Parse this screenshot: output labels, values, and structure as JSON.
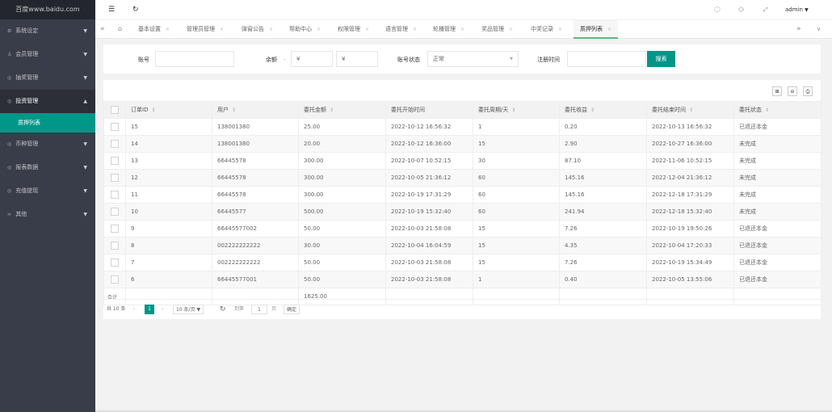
{
  "app": {
    "logo": "百度www.baidu.com"
  },
  "sidebar": {
    "items": [
      {
        "icon": "⚙",
        "label": "系统设定"
      },
      {
        "icon": "♙",
        "label": "会员管理"
      },
      {
        "icon": "◎",
        "label": "抽奖管理"
      },
      {
        "icon": "◎",
        "label": "投资管理"
      },
      {
        "icon": "◎",
        "label": "币种管理"
      },
      {
        "icon": "◎",
        "label": "报表数据"
      },
      {
        "icon": "◎",
        "label": "充值提现"
      },
      {
        "icon": "∞",
        "label": "其他"
      }
    ],
    "active_sub": "质押列表"
  },
  "topbar": {
    "user": "admin"
  },
  "tabs": [
    "基本设置",
    "管理员管理",
    "弹窗公告",
    "帮助中心",
    "权限管理",
    "语言管理",
    "轮播管理",
    "奖品管理",
    "中奖记录",
    "质押列表"
  ],
  "search": {
    "account_label": "账号",
    "balance_label": "余额",
    "balance_sep": "-",
    "min_placeholder": "¥",
    "max_placeholder": "¥",
    "status_label": "账号状态",
    "status_value": "正常",
    "regtime_label": "注册时间",
    "search_button": "搜索"
  },
  "table": {
    "columns": [
      "订单ID",
      "用户",
      "委托金额",
      "委托开始时间",
      "委托周期/天",
      "委托收益",
      "委托结束时间",
      "委托状态"
    ],
    "rows": [
      [
        "15",
        "138001380",
        "25.00",
        "2022-10-12 16:56:32",
        "1",
        "0.20",
        "2022-10-13 16:56:32",
        "已退还本金"
      ],
      [
        "14",
        "138001380",
        "20.00",
        "2022-10-12 16:36:00",
        "15",
        "2.90",
        "2022-10-27 16:36:00",
        "未完成"
      ],
      [
        "13",
        "66445578",
        "300.00",
        "2022-10-07 10:52:15",
        "30",
        "87.10",
        "2022-11-06 10:52:15",
        "未完成"
      ],
      [
        "12",
        "66445578",
        "300.00",
        "2022-10-05 21:36:12",
        "60",
        "145.16",
        "2022-12-04 21:36:12",
        "未完成"
      ],
      [
        "11",
        "66445578",
        "300.00",
        "2022-10-19 17:31:29",
        "60",
        "145.16",
        "2022-12-18 17:31:29",
        "未完成"
      ],
      [
        "10",
        "66445577",
        "500.00",
        "2022-10-19 15:32:40",
        "60",
        "241.94",
        "2022-12-18 15:32:40",
        "未完成"
      ],
      [
        "9",
        "66445577002",
        "50.00",
        "2022-10-03 21:58:08",
        "15",
        "7.26",
        "2022-10-19 19:50:26",
        "已退还本金"
      ],
      [
        "8",
        "002222222222",
        "30.00",
        "2022-10-04 16:04:59",
        "15",
        "4.35",
        "2022-10-04 17:20:33",
        "已退还本金"
      ],
      [
        "7",
        "002222222222",
        "50.00",
        "2022-10-03 21:58:08",
        "15",
        "7.26",
        "2022-10-19 15:34:49",
        "已退还本金"
      ],
      [
        "6",
        "66445577001",
        "50.00",
        "2022-10-03 21:58:08",
        "1",
        "0.40",
        "2022-10-05 13:55:06",
        "已退还本金"
      ]
    ],
    "total_label": "合计",
    "total_amount": "1625.00"
  },
  "pager": {
    "total": "共 10 条",
    "current": "1",
    "page_size": "10 条/页",
    "goto_label": "到第",
    "goto_value": "1",
    "page_unit": "页",
    "confirm": "确定"
  }
}
